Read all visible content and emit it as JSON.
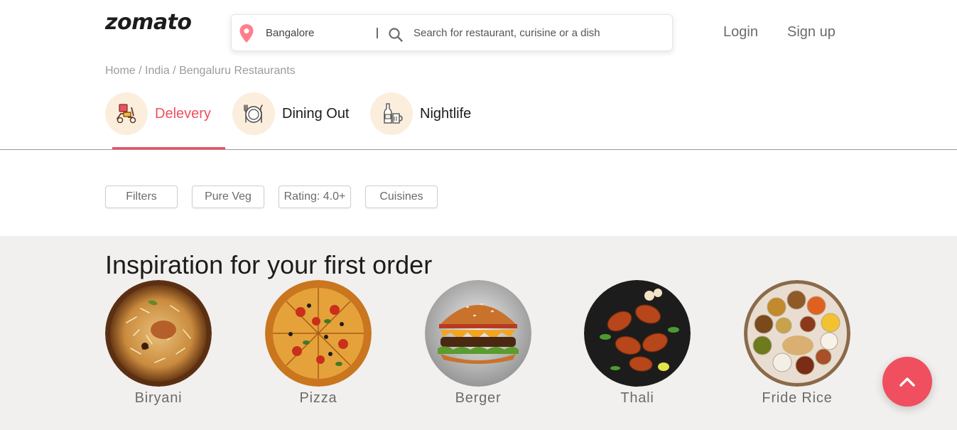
{
  "header": {
    "logo": "zomato",
    "location": "Bangalore",
    "search_placeholder": "Search for restaurant, curisine or a dish",
    "login": "Login",
    "signup": "Sign up"
  },
  "breadcrumb": {
    "home": "Home",
    "sep": " / ",
    "country": "India",
    "city": "Bengaluru Restaurants"
  },
  "tabs": [
    {
      "label": "Delevery",
      "icon": "delivery-scooter-icon",
      "active": true
    },
    {
      "label": "Dining Out",
      "icon": "dining-plate-icon",
      "active": false
    },
    {
      "label": "Nightlife",
      "icon": "nightlife-bottle-icon",
      "active": false
    }
  ],
  "filters": [
    "Filters",
    "Pure Veg",
    "Rating: 4.0+",
    "Cuisines"
  ],
  "inspiration": {
    "title": "Inspiration for your first order",
    "items": [
      {
        "name": "Biryani"
      },
      {
        "name": "Pizza"
      },
      {
        "name": "Berger"
      },
      {
        "name": "Thali"
      },
      {
        "name": "Fride Rice"
      }
    ]
  },
  "colors": {
    "accent": "#ef4f5f",
    "tab_circle": "#fbeedd",
    "section_bg": "#f1f0ee",
    "muted_text": "#6b6b6b"
  }
}
